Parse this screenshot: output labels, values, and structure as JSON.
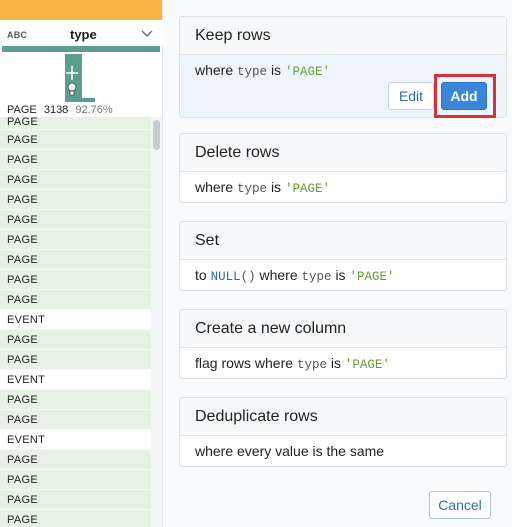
{
  "column": {
    "type_label": "ABC",
    "name": "type",
    "stat_value": "PAGE",
    "stat_count": "3138",
    "stat_percent": "92.76%"
  },
  "rows": [
    "PAGE",
    "PAGE",
    "PAGE",
    "PAGE",
    "PAGE",
    "PAGE",
    "PAGE",
    "PAGE",
    "PAGE",
    "PAGE",
    "EVENT",
    "PAGE",
    "PAGE",
    "EVENT",
    "PAGE",
    "PAGE",
    "EVENT",
    "PAGE",
    "PAGE",
    "PAGE",
    "PAGE"
  ],
  "colors": {
    "header_strip": "#f5b342",
    "histogram": "#5c9d92",
    "row_bg": "#e6f2e4",
    "add_button": "#3a87d9",
    "highlight": "#d9313a"
  },
  "suggestions": {
    "keep": {
      "title": "Keep rows",
      "where": "where",
      "column": "type",
      "is": "is",
      "value": "'PAGE'",
      "edit_label": "Edit",
      "add_label": "Add"
    },
    "delete": {
      "title": "Delete rows",
      "where": "where",
      "column": "type",
      "is": "is",
      "value": "'PAGE'"
    },
    "set": {
      "title": "Set",
      "to": "to",
      "fn": "NULL",
      "parens": "()",
      "where": "where",
      "column": "type",
      "is": "is",
      "value": "'PAGE'"
    },
    "new_column": {
      "title": "Create a new column",
      "prefix": "flag rows where",
      "column": "type",
      "is": "is",
      "value": "'PAGE'"
    },
    "dedupe": {
      "title": "Deduplicate rows",
      "text": "where every value is the same"
    }
  },
  "cancel_label": "Cancel"
}
